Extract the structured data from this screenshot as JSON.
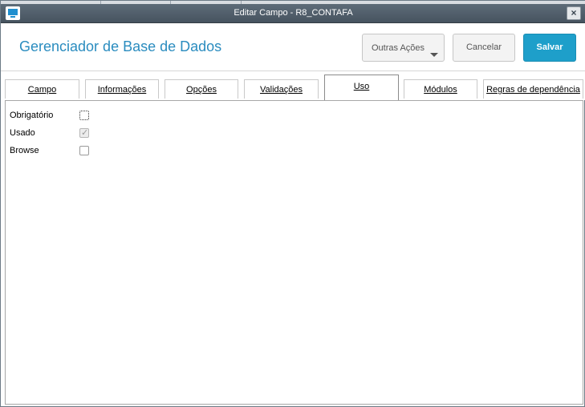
{
  "window": {
    "title": "Editar Campo - R8_CONTAFA"
  },
  "header": {
    "app_title": "Gerenciador de Base de Dados",
    "more_actions_label": "Outras Ações",
    "cancel_label": "Cancelar",
    "save_label": "Salvar"
  },
  "tabs": [
    {
      "label": "Campo",
      "active": false
    },
    {
      "label": "Informações",
      "active": false
    },
    {
      "label": "Opções",
      "active": false
    },
    {
      "label": "Validações",
      "active": false
    },
    {
      "label": "Uso",
      "active": true
    },
    {
      "label": "Módulos",
      "active": false
    },
    {
      "label": "Regras de dependência",
      "active": false
    }
  ],
  "uso": {
    "fields": [
      {
        "label": "Obrigatório",
        "checked": false,
        "enabled": true
      },
      {
        "label": "Usado",
        "checked": true,
        "enabled": false
      },
      {
        "label": "Browse",
        "checked": false,
        "enabled": true
      }
    ]
  },
  "colors": {
    "accent": "#1e9fca",
    "title": "#2a8cbf",
    "titlebar": "#4f5c68"
  }
}
